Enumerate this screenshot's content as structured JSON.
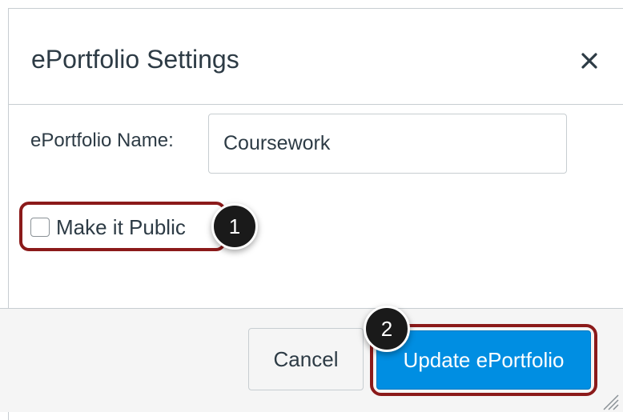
{
  "dialog": {
    "title": "ePortfolio Settings",
    "close_icon": "close-icon"
  },
  "form": {
    "name_label": "ePortfolio Name:",
    "name_value": "Coursework",
    "public_label": "Make it Public",
    "public_checked": false
  },
  "footer": {
    "cancel_label": "Cancel",
    "update_label": "Update ePortfolio"
  },
  "callouts": {
    "first": "1",
    "second": "2"
  },
  "colors": {
    "primary_button": "#008ee2",
    "highlight_border": "#8b1a1a",
    "callout_bg": "#1a1a1a",
    "text": "#2d3b45"
  }
}
